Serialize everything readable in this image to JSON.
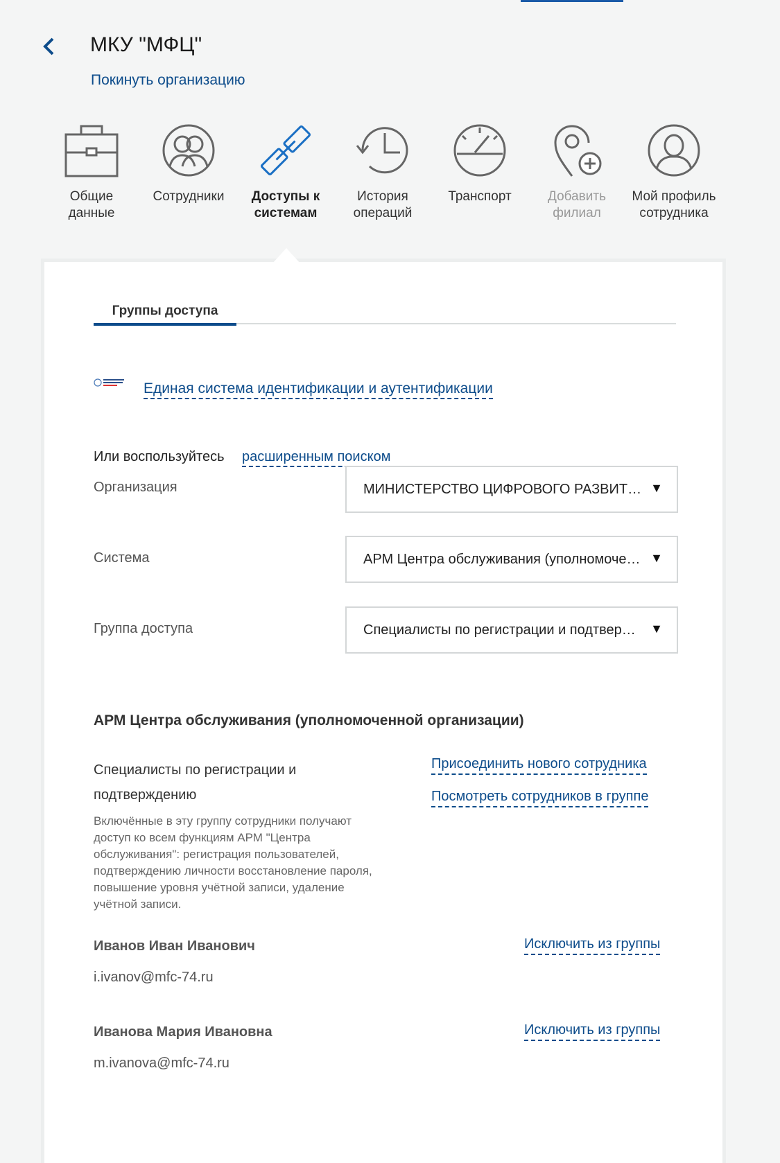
{
  "header": {
    "title": "МКУ \"МФЦ\"",
    "leave_link": "Покинуть организацию"
  },
  "nav": [
    {
      "label": "Общие\nданные",
      "icon": "briefcase-icon"
    },
    {
      "label": "Сотрудники",
      "icon": "employees-icon"
    },
    {
      "label": "Доступы к\nсистемам",
      "icon": "link-icon"
    },
    {
      "label": "История\nопераций",
      "icon": "history-icon"
    },
    {
      "label": "Транспорт",
      "icon": "speedometer-icon"
    },
    {
      "label": "Добавить\nфилиал",
      "icon": "add-location-icon"
    },
    {
      "label": "Мой профиль\nсотрудника",
      "icon": "profile-icon"
    }
  ],
  "tabs": {
    "access_groups": "Группы доступа"
  },
  "esia": {
    "link": "Единая система идентификации и аутентификации"
  },
  "advanced": {
    "text": "Или воспользуйтесь",
    "link": "расширенным поиском"
  },
  "form": {
    "org_label": "Организация",
    "org_value": "МИНИСТЕРСТВО ЦИФРОВОГО РАЗВИТ…",
    "system_label": "Система",
    "system_value": "АРМ Центра обслуживания (уполномоче…",
    "group_label": "Группа доступа",
    "group_value": "Специалисты по регистрации и подтвер…",
    "arrow": "▼"
  },
  "section": {
    "title": "АРМ Центра обслуживания (уполномоченной организации)",
    "group_name": "Специалисты по регистрации и подтверждению",
    "group_desc": "Включённые в эту группу сотрудники получают доступ ко всем функциям АРМ \"Центра обслуживания\": регистрация пользователей, подтверждению личности восстановление пароля, повышение уровня учётной записи, удаление учётной записи.",
    "add_link": "Присоединить нового сотрудника",
    "view_link": "Посмотреть сотрудников в группе"
  },
  "members": [
    {
      "name": "Иванов Иван Иванович",
      "email": "i.ivanov@mfc-74.ru",
      "action": "Исключить из группы"
    },
    {
      "name": "Иванова Мария Ивановна",
      "email": "m.ivanova@mfc-74.ru",
      "action": "Исключить из группы"
    }
  ],
  "colors": {
    "link": "#0d4c8b",
    "active_icon": "#1a6fc4",
    "icon": "#666666"
  }
}
